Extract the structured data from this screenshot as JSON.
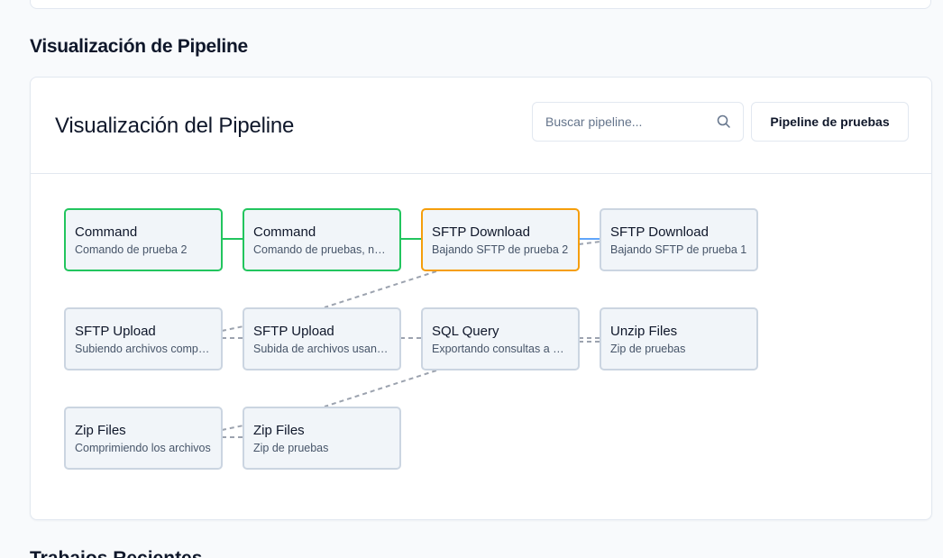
{
  "section": {
    "title": "Visualización de Pipeline"
  },
  "card": {
    "title": "Visualización del Pipeline",
    "search": {
      "placeholder": "Buscar pipeline...",
      "value": ""
    },
    "pipeline_button": "Pipeline de pruebas"
  },
  "nodes": [
    {
      "title": "Command",
      "desc": "Comando de prueba 2",
      "status": "success"
    },
    {
      "title": "Command",
      "desc": "Comando de pruebas, nuevamente",
      "status": "success"
    },
    {
      "title": "SFTP Download",
      "desc": "Bajando SFTP de prueba 2",
      "status": "running"
    },
    {
      "title": "SFTP Download",
      "desc": "Bajando SFTP de prueba 1",
      "status": "pending"
    },
    {
      "title": "SFTP Upload",
      "desc": "Subiendo archivos comprimidos",
      "status": "pending"
    },
    {
      "title": "SFTP Upload",
      "desc": "Subida de archivos usando SFTP",
      "status": "pending"
    },
    {
      "title": "SQL Query",
      "desc": "Exportando consultas a CSV",
      "status": "pending"
    },
    {
      "title": "Unzip Files",
      "desc": "Zip de pruebas",
      "status": "pending"
    },
    {
      "title": "Zip Files",
      "desc": "Comprimiendo los archivos",
      "status": "pending"
    },
    {
      "title": "Zip Files",
      "desc": "Zip de pruebas",
      "status": "pending"
    }
  ],
  "colors": {
    "success": "#22c55e",
    "running": "#f59e0b",
    "pending": "#cbd5e1",
    "active_edge": "#60a5fa",
    "dashed_edge": "#9ca3af"
  },
  "next_section": {
    "title": "Trabajos Recientes"
  }
}
